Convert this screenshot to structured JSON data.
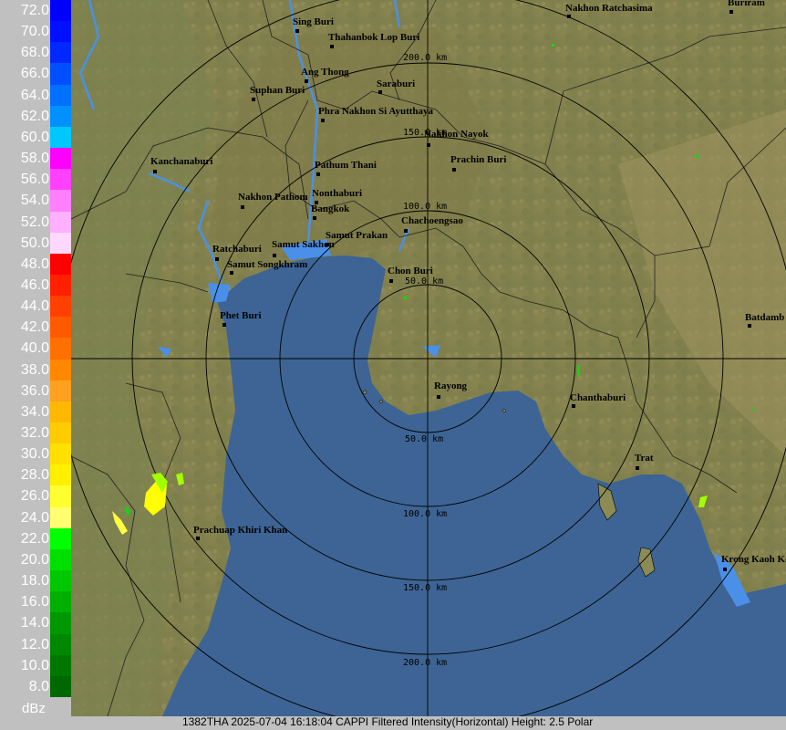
{
  "legend": {
    "unit": "dBz",
    "levels": [
      {
        "label": "72.0",
        "color": "#0000ff"
      },
      {
        "label": "70.0",
        "color": "#0010ff"
      },
      {
        "label": "68.0",
        "color": "#0028ff"
      },
      {
        "label": "66.0",
        "color": "#0050ff"
      },
      {
        "label": "64.0",
        "color": "#0070ff"
      },
      {
        "label": "62.0",
        "color": "#0090ff"
      },
      {
        "label": "60.0",
        "color": "#00c8ff"
      },
      {
        "label": "58.0",
        "color": "#ff00ff"
      },
      {
        "label": "56.0",
        "color": "#ff40ff"
      },
      {
        "label": "54.0",
        "color": "#ff80ff"
      },
      {
        "label": "52.0",
        "color": "#ffb0ff"
      },
      {
        "label": "50.0",
        "color": "#ffd8ff"
      },
      {
        "label": "48.0",
        "color": "#ff0000"
      },
      {
        "label": "46.0",
        "color": "#ff2000"
      },
      {
        "label": "44.0",
        "color": "#ff4000"
      },
      {
        "label": "42.0",
        "color": "#ff5a00"
      },
      {
        "label": "40.0",
        "color": "#ff7000"
      },
      {
        "label": "38.0",
        "color": "#ff8800"
      },
      {
        "label": "36.0",
        "color": "#ffa020"
      },
      {
        "label": "34.0",
        "color": "#ffb800"
      },
      {
        "label": "32.0",
        "color": "#ffcc00"
      },
      {
        "label": "30.0",
        "color": "#ffe000"
      },
      {
        "label": "28.0",
        "color": "#fff000"
      },
      {
        "label": "26.0",
        "color": "#ffff30"
      },
      {
        "label": "24.0",
        "color": "#ffff70"
      },
      {
        "label": "22.0",
        "color": "#00ff00"
      },
      {
        "label": "20.0",
        "color": "#00e000"
      },
      {
        "label": "18.0",
        "color": "#00c800"
      },
      {
        "label": "16.0",
        "color": "#00b000"
      },
      {
        "label": "14.0",
        "color": "#009800"
      },
      {
        "label": "12.0",
        "color": "#008800"
      },
      {
        "label": "10.0",
        "color": "#007800"
      },
      {
        "label": "8.0",
        "color": "#006800"
      }
    ]
  },
  "rings": {
    "labels_north": [
      "50.0 km",
      "100.0 km",
      "150.0 km",
      "200.0 km"
    ],
    "labels_south": [
      "50.0 km",
      "100.0 km",
      "150.0 km",
      "200.0 km"
    ]
  },
  "cities": [
    "Sing Buri",
    "Thahanbok Lop Buri",
    "Ang Thong",
    "Suphan Buri",
    "Saraburi",
    "Phra Nakhon Si Ayutthaya",
    "Nakhon Nayok",
    "Prachin Buri",
    "Kanchanaburi",
    "Pathum Thani",
    "Nonthaburi",
    "Nakhon Pathom",
    "Bangkok",
    "Chachoengsao",
    "Samut Prakan",
    "Samut Sakhon",
    "Ratchaburi",
    "Samut Songkhram",
    "Chon Buri",
    "Phet Buri",
    "Rayong",
    "Chanthaburi",
    "Trat",
    "Prachuap Khiri Khan",
    "Nakhon Ratchasima",
    "Buriram",
    "Batdamb",
    "Krong Kaoh Ko"
  ],
  "colors": {
    "land": "#8c8a55",
    "sea": "#3d6494",
    "river": "#4a90e8"
  },
  "footer": {
    "text": "1382THA 2025-07-04 16:18:04 CAPPI Filtered Intensity(Horizontal)  Height: 2.5 Polar"
  }
}
